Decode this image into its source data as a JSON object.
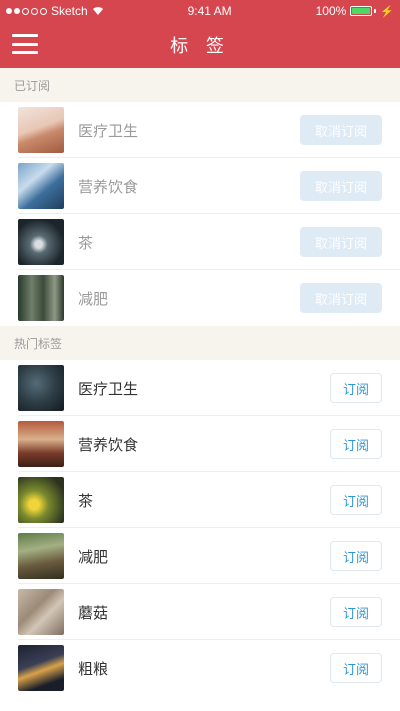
{
  "status_bar": {
    "carrier": "Sketch",
    "time": "9:41 AM",
    "battery": "100%",
    "battery_level": 1.0
  },
  "nav": {
    "title": "标 签",
    "menu_icon": "hamburger-menu-icon"
  },
  "subscribed": {
    "header": "已订阅",
    "action_label": "取消订阅",
    "items": [
      {
        "label": "医疗卫生"
      },
      {
        "label": "营养饮食"
      },
      {
        "label": "茶"
      },
      {
        "label": "减肥"
      }
    ]
  },
  "hot_tags": {
    "header": "热门标签",
    "action_label": "订阅",
    "items": [
      {
        "label": "医疗卫生"
      },
      {
        "label": "营养饮食"
      },
      {
        "label": "茶"
      },
      {
        "label": "减肥"
      },
      {
        "label": "蘑菇"
      },
      {
        "label": "粗粮"
      }
    ]
  },
  "colors": {
    "brand_red": "#d6464f",
    "link_blue": "#2f95d6",
    "disabled_blue": "#dbe8f3",
    "section_bg": "#f7f4ee"
  }
}
